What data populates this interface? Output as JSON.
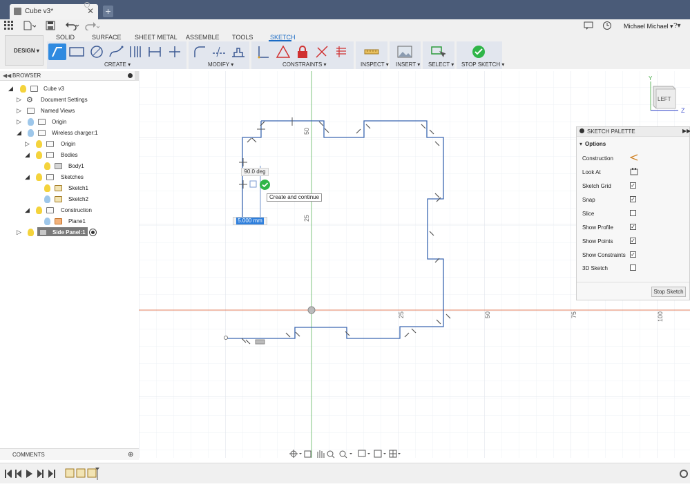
{
  "window": {
    "doc_tab_title": "Cube v3*",
    "new_tab_symbol": "+",
    "close_symbol": "✕"
  },
  "qat": {
    "user": "Michael Michael ▾",
    "help": "?▾"
  },
  "workspace": {
    "label": "DESIGN ▾"
  },
  "ribbon_tabs": [
    {
      "label": "SOLID"
    },
    {
      "label": "SURFACE"
    },
    {
      "label": "SHEET METAL"
    },
    {
      "label": "ASSEMBLE"
    },
    {
      "label": "TOOLS"
    },
    {
      "label": "SKETCH"
    }
  ],
  "active_tab": "SKETCH",
  "ribbon_groups": {
    "create": "CREATE ▾",
    "modify": "MODIFY ▾",
    "constraints": "CONSTRAINTS ▾",
    "inspect": "INSPECT ▾",
    "insert": "INSERT ▾",
    "select": "SELECT ▾",
    "stop_sketch": "STOP SKETCH ▾"
  },
  "browser": {
    "title": "BROWSER",
    "items": [
      {
        "label": "Cube v3"
      },
      {
        "label": "Document Settings"
      },
      {
        "label": "Named Views"
      },
      {
        "label": "Origin"
      },
      {
        "label": "Wireless charger:1"
      },
      {
        "label": "Origin"
      },
      {
        "label": "Bodies"
      },
      {
        "label": "Body1"
      },
      {
        "label": "Sketches"
      },
      {
        "label": "Sketch1"
      },
      {
        "label": "Sketch2"
      },
      {
        "label": "Construction"
      },
      {
        "label": "Plane1"
      },
      {
        "label": "Side Panel:1"
      }
    ]
  },
  "comments": {
    "title": "COMMENTS"
  },
  "canvas": {
    "axis_labels": [
      "50",
      "25",
      "25",
      "50",
      "75",
      "100"
    ],
    "angle_input": "90.0 deg",
    "length_input": "5.000 mm",
    "tooltip": "Create and continue",
    "viewcube_label": "LEFT",
    "axis_y": "Y",
    "axis_z": "Z"
  },
  "palette": {
    "title": "SKETCH PALETTE",
    "section": "Options",
    "rows": [
      {
        "label": "Construction",
        "checked": null
      },
      {
        "label": "Look At",
        "checked": null
      },
      {
        "label": "Sketch Grid",
        "checked": true
      },
      {
        "label": "Snap",
        "checked": true
      },
      {
        "label": "Slice",
        "checked": false
      },
      {
        "label": "Show Profile",
        "checked": true
      },
      {
        "label": "Show Points",
        "checked": true
      },
      {
        "label": "Show Constraints",
        "checked": true
      },
      {
        "label": "3D Sketch",
        "checked": false
      }
    ],
    "stop_button": "Stop Sketch"
  },
  "colors": {
    "titlebar": "#4a5b78",
    "accent": "#1a6bc5",
    "sketch_line": "#3a66b0",
    "x_axis": "#e07b5a",
    "y_axis": "#7cc37c",
    "confirm_green": "#2fb548"
  }
}
